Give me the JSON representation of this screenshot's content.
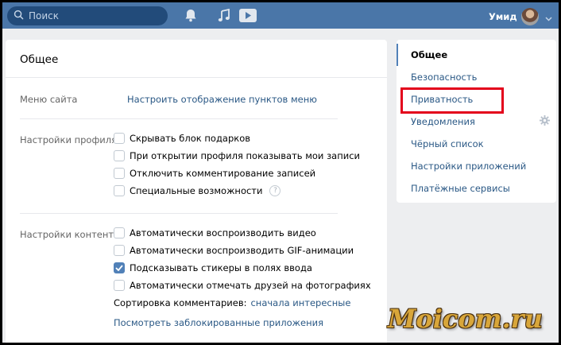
{
  "header": {
    "search_placeholder": "Поиск",
    "user_name": "Умид"
  },
  "main": {
    "title": "Общее",
    "site_menu": {
      "label": "Меню сайта",
      "link": "Настроить отображение пунктов меню"
    },
    "profile": {
      "label": "Настройки профиля",
      "options": [
        {
          "label": "Скрывать блок подарков",
          "checked": false
        },
        {
          "label": "При открытии профиля показывать мои записи",
          "checked": false
        },
        {
          "label": "Отключить комментирование записей",
          "checked": false
        },
        {
          "label": "Специальные возможности",
          "checked": false
        }
      ],
      "help": "?"
    },
    "content": {
      "label": "Настройки контента",
      "options": [
        {
          "label": "Автоматически воспроизводить видео",
          "checked": false
        },
        {
          "label": "Автоматически воспроизводить GIF-анимации",
          "checked": false
        },
        {
          "label": "Подсказывать стикеры в полях ввода",
          "checked": true
        },
        {
          "label": "Автоматически отмечать друзей на фотографиях",
          "checked": false
        }
      ],
      "sort_label": "Сортировка комментариев:",
      "sort_value": "сначала интересные",
      "blocked_apps_link": "Посмотреть заблокированные приложения"
    }
  },
  "side_menu": {
    "items": [
      {
        "label": "Общее",
        "active": true
      },
      {
        "label": "Безопасность"
      },
      {
        "label": "Приватность"
      },
      {
        "label": "Уведомления"
      },
      {
        "label": "Чёрный список"
      },
      {
        "label": "Настройки приложений"
      },
      {
        "label": "Платёжные сервисы"
      }
    ]
  },
  "watermark": "Moicom.ru",
  "colors": {
    "header": "#4a76a8",
    "link": "#2a5885",
    "highlight": "#e3001b",
    "checkbox_checked": "#5181b8"
  }
}
